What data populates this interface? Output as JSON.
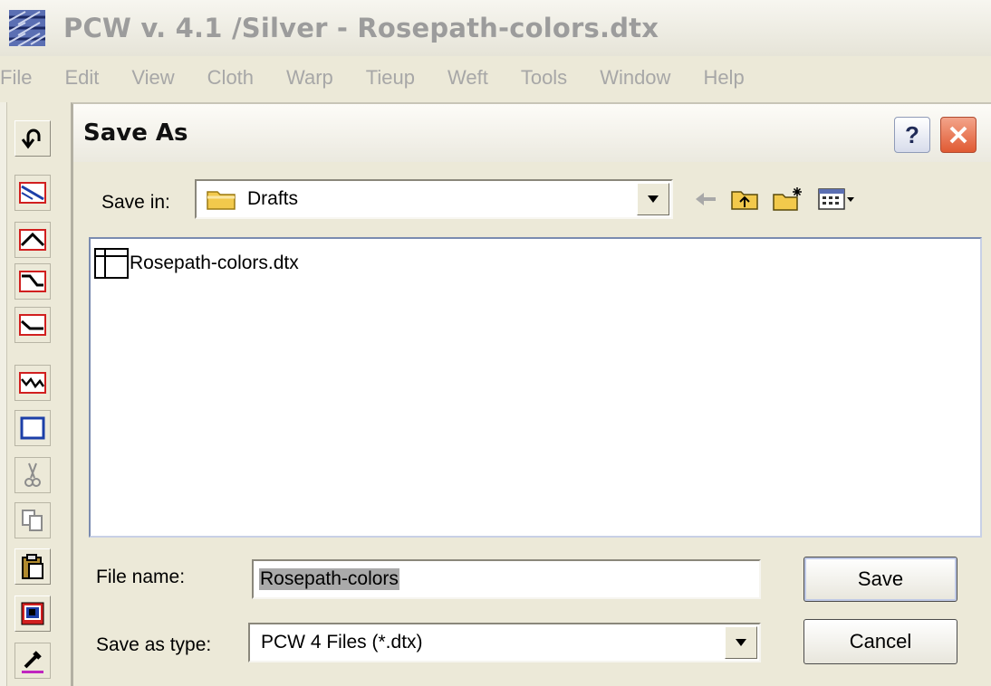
{
  "app": {
    "title": "PCW v. 4.1 /Silver - Rosepath-colors.dtx",
    "icon": "weave-draft-icon"
  },
  "menu": [
    "File",
    "Edit",
    "View",
    "Cloth",
    "Warp",
    "Tieup",
    "Weft",
    "Tools",
    "Window",
    "Help"
  ],
  "toolbar": {
    "tools": [
      "undo-icon",
      "threading-straight-icon",
      "threading-point-icon",
      "threading-step-icon",
      "threading-broken-icon",
      "threading-random-icon",
      "rectangle-select-icon",
      "cut-icon",
      "copy-icon",
      "paste-icon",
      "copy-window-icon",
      "eyedropper-icon"
    ]
  },
  "dialog": {
    "title": "Save As",
    "help_label": "?",
    "save_in_label": "Save in:",
    "save_in_value": "Drafts",
    "files": [
      "Rosepath-colors.dtx"
    ],
    "file_name_label": "File name:",
    "file_name_value": "Rosepath-colors",
    "save_as_type_label": "Save as type:",
    "save_as_type_value": "PCW 4 Files (*.dtx)",
    "save_label": "Save",
    "cancel_label": "Cancel"
  },
  "colors": {
    "close_button": "#e05a33",
    "dialog_bg": "#ece9d8",
    "folder": "#f2c94c",
    "tool_red": "#d11f1f",
    "tool_blue": "#1c3fa8"
  }
}
